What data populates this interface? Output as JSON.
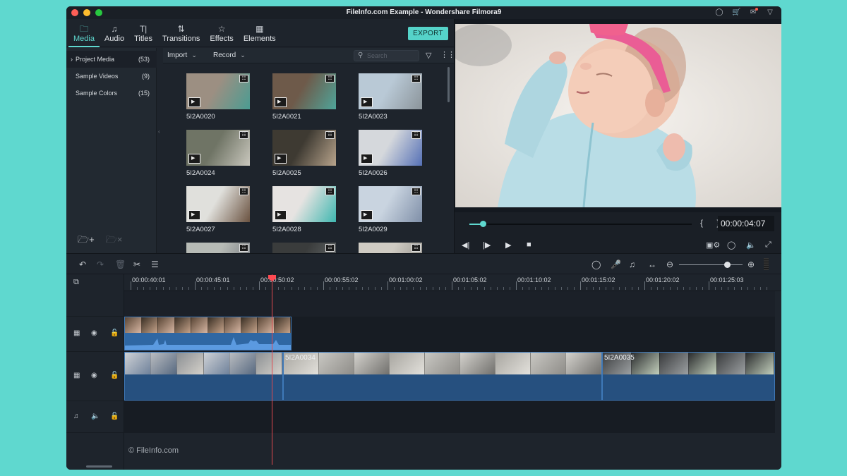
{
  "window": {
    "title": "FileInfo.com Example - Wondershare Filmora9",
    "titlebar_icons": [
      "user-icon",
      "cart-icon",
      "mail-icon",
      "notification-icon"
    ]
  },
  "tabs": [
    {
      "label": "Media",
      "icon": "folder-icon",
      "active": true
    },
    {
      "label": "Audio",
      "icon": "music-icon",
      "active": false
    },
    {
      "label": "Titles",
      "icon": "text-icon",
      "active": false
    },
    {
      "label": "Transitions",
      "icon": "transition-icon",
      "active": false
    },
    {
      "label": "Effects",
      "icon": "effects-icon",
      "active": false
    },
    {
      "label": "Elements",
      "icon": "image-icon",
      "active": false
    }
  ],
  "export_label": "EXPORT",
  "library": {
    "items": [
      {
        "label": "Project Media",
        "count": "(53)",
        "selected": true
      },
      {
        "label": "Sample Videos",
        "count": "(9)",
        "selected": false
      },
      {
        "label": "Sample Colors",
        "count": "(15)",
        "selected": false
      }
    ]
  },
  "browser": {
    "import_label": "Import",
    "record_label": "Record",
    "search_placeholder": "Search",
    "thumbnails": [
      {
        "name": "5I2A0020",
        "colors": [
          "#9c8f82",
          "#4b9c92"
        ]
      },
      {
        "name": "5I2A0021",
        "colors": [
          "#6e5a4a",
          "#4fa59a"
        ]
      },
      {
        "name": "5I2A0023",
        "colors": [
          "#b9c9d6",
          "#8b949a"
        ]
      },
      {
        "name": "5I2A0024",
        "colors": [
          "#6f7465",
          "#c9c7bd"
        ]
      },
      {
        "name": "5I2A0025",
        "colors": [
          "#3e3a32",
          "#b8a48c"
        ]
      },
      {
        "name": "5I2A0026",
        "colors": [
          "#d5d8dc",
          "#5570b6"
        ]
      },
      {
        "name": "5I2A0027",
        "colors": [
          "#e0e0dc",
          "#6a5240"
        ]
      },
      {
        "name": "5I2A0028",
        "colors": [
          "#e6e3e1",
          "#3fb7b0"
        ]
      },
      {
        "name": "5I2A0029",
        "colors": [
          "#c9d4e0",
          "#7f8fa8"
        ]
      },
      {
        "name": "",
        "colors": [
          "#b7bbb6",
          "#6b7078"
        ]
      },
      {
        "name": "",
        "colors": [
          "#3a3c3c",
          "#6a6f70"
        ]
      },
      {
        "name": "",
        "colors": [
          "#cfcbc3",
          "#8c8a85"
        ]
      }
    ]
  },
  "preview": {
    "timecode": "00:00:04:07",
    "progress": 0.06,
    "brackets": "{ }"
  },
  "timeline": {
    "ruler_labels": [
      "00:00:40:01",
      "00:00:45:01",
      "00:00:50:02",
      "00:00:55:02",
      "00:01:00:02",
      "00:01:05:02",
      "00:01:10:02",
      "00:01:15:02",
      "00:01:20:02",
      "00:01:25:03"
    ],
    "zoom_level": 0.75,
    "clips": [
      {
        "label": "5I2A0034"
      },
      {
        "label": "5I2A0035"
      }
    ],
    "watermark": "© FileInfo.com"
  }
}
